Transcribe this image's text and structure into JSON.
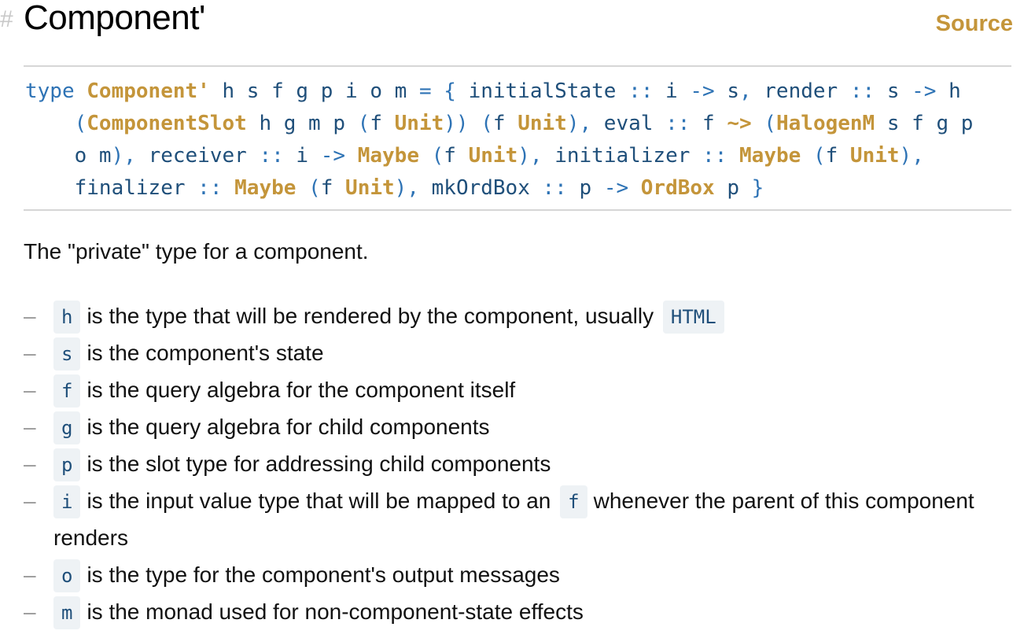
{
  "header": {
    "anchor": "#",
    "title": "Component'",
    "source_label": "Source"
  },
  "signature": {
    "kw_type": "type",
    "name": "Component'",
    "line1_rest": " h s f g p i o m ",
    "eq": "=",
    "lbrace": "{",
    "f_initialState": "initialState",
    "colons": "::",
    "arrow": "->",
    "comma": ",",
    "f_render": "render",
    "ComponentSlot": "ComponentSlot",
    "Unit": "Unit",
    "f_eval": "eval",
    "nat": "~>",
    "HalogenM": "HalogenM",
    "f_receiver": "receiver",
    "Maybe": "Maybe",
    "f_initializer": "initializer",
    "f_finalizer": "finalizer",
    "f_mkOrdBox": "mkOrdBox",
    "OrdBox": "OrdBox",
    "rbrace": "}"
  },
  "description": "The \"private\" type for a component.",
  "params": [
    {
      "code": "h",
      "text": "is the type that will be rendered by the component, usually",
      "extra_code": "HTML"
    },
    {
      "code": "s",
      "text": "is the component's state"
    },
    {
      "code": "f",
      "text": "is the query algebra for the component itself"
    },
    {
      "code": "g",
      "text": "is the query algebra for child components"
    },
    {
      "code": "p",
      "text": "is the slot type for addressing child components"
    },
    {
      "code": "i",
      "text": "is the input value type that will be mapped to an",
      "extra_code": "f",
      "text_after": "whenever the parent of this component renders"
    },
    {
      "code": "o",
      "text": "is the type for the component's output messages"
    },
    {
      "code": "m",
      "text": "is the monad used for non-component-state effects"
    }
  ],
  "list_dash": "–",
  "colors": {
    "accent": "#c4953a",
    "code_text": "#1f4f7a",
    "keyword": "#2e73b5",
    "code_bg": "#eef2f5"
  }
}
